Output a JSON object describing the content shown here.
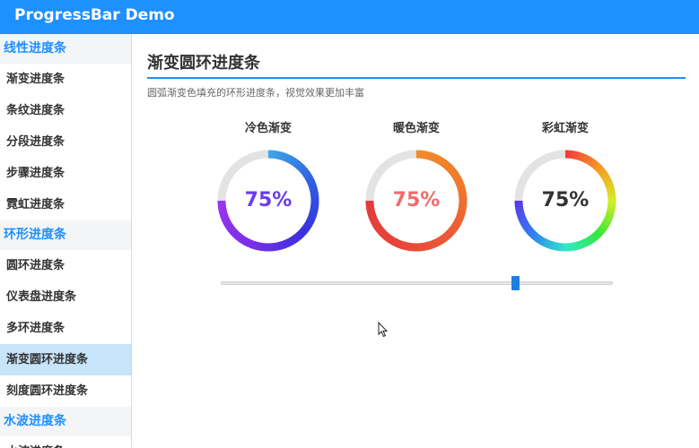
{
  "app": {
    "title": "ProgressBar Demo"
  },
  "sidebar": {
    "sections": [
      {
        "label": "线性进度条",
        "items": [
          {
            "label": "渐变进度条",
            "active": false
          },
          {
            "label": "条纹进度条",
            "active": false
          },
          {
            "label": "分段进度条",
            "active": false
          },
          {
            "label": "步骤进度条",
            "active": false
          },
          {
            "label": "霓虹进度条",
            "active": false
          }
        ]
      },
      {
        "label": "环形进度条",
        "items": [
          {
            "label": "圆环进度条",
            "active": false
          },
          {
            "label": "仪表盘进度条",
            "active": false
          },
          {
            "label": "多环进度条",
            "active": false
          },
          {
            "label": "渐变圆环进度条",
            "active": true
          },
          {
            "label": "刻度圆环进度条",
            "active": false
          }
        ]
      },
      {
        "label": "水波进度条",
        "items": [
          {
            "label": "水波进度条",
            "active": false
          }
        ]
      }
    ]
  },
  "main": {
    "title": "渐变圆环进度条",
    "subtitle": "圆弧渐变色填充的环形进度条，视觉效果更加丰富",
    "rings": [
      {
        "title": "冷色渐变",
        "value_text": "75%",
        "progress": 0.75,
        "text_color": "#6a3de8",
        "colors": [
          "#3ea6e8",
          "#2f5de0",
          "#3b2fe0",
          "#7a2fe8",
          "#9b35f0"
        ]
      },
      {
        "title": "暖色渐变",
        "value_text": "75%",
        "progress": 0.75,
        "text_color": "#ee6c6c",
        "colors": [
          "#f08a2a",
          "#ee7a2c",
          "#ec5a35",
          "#e8453a",
          "#e33b3b"
        ]
      },
      {
        "title": "彩虹渐变",
        "value_text": "75%",
        "progress": 0.75,
        "text_color": "#333333",
        "colors": [
          "#f33a3a",
          "#f59a22",
          "#d6ef2a",
          "#34e83a",
          "#2fe8c8",
          "#2f7ff0",
          "#5a3ae8"
        ]
      }
    ],
    "slider": {
      "value": 0.75
    }
  },
  "colors": {
    "accent": "#1e90ff",
    "track": "#e3e3e3"
  },
  "icons": {
    "cursor": "arrow-cursor-icon"
  }
}
